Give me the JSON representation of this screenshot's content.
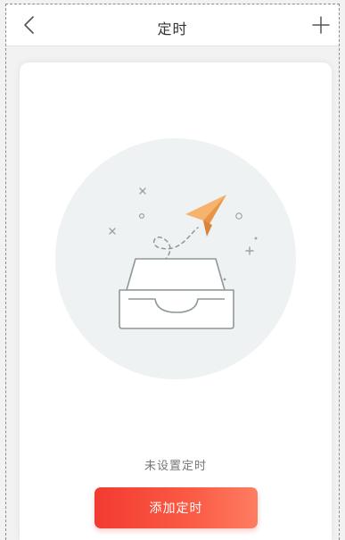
{
  "header": {
    "title": "定时",
    "back_icon": "chevron-left-icon",
    "add_icon": "plus-icon"
  },
  "empty_state": {
    "illustration": "paper-plane-inbox-illustration",
    "message": "未设置定时"
  },
  "actions": {
    "add_timer_label": "添加定时"
  },
  "colors": {
    "accent": "#f23b31",
    "accent_end": "#fd7d62",
    "plane": "#f5b36d",
    "illustration_bg": "#eff2f2"
  }
}
